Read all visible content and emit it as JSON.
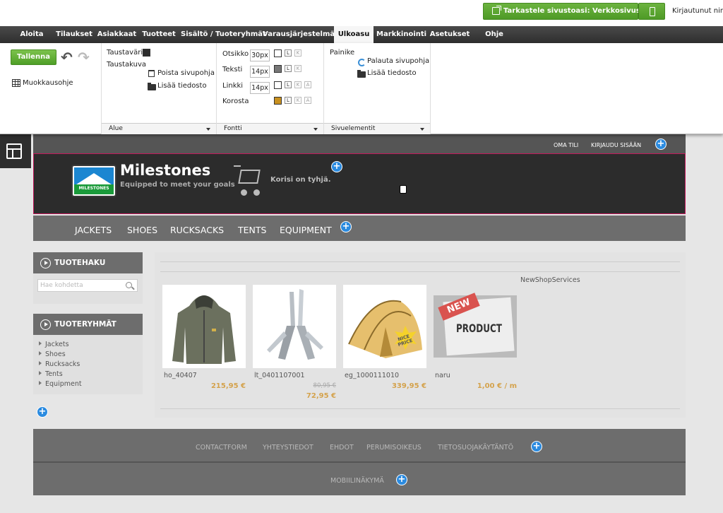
{
  "topbar": {
    "view_site_label": "Tarkastele sivustoasi: Verkkosivusto",
    "logged_in": "Kirjautunut nime"
  },
  "menu": [
    "Aloita",
    "Tilaukset",
    "Asiakkaat",
    "Tuotteet",
    "Sisältö / Tuoteryhmät",
    "Varausjärjestelmä",
    "Ulkoasu",
    "Markkinointi",
    "Asetukset",
    "Ohje"
  ],
  "menu_active": "Ulkoasu",
  "ribbon": {
    "save": "Tallenna",
    "help": "Muokkausohje",
    "area": {
      "bg_color": "Taustaväri",
      "bg_image": "Taustakuva",
      "remove_template": "Poista sivupohja",
      "add_file": "Lisää tiedosto",
      "footer": "Alue"
    },
    "font": {
      "rows": [
        {
          "label": "Otsikko",
          "size": "30px",
          "color": "#ffffff"
        },
        {
          "label": "Teksti",
          "size": "14px",
          "color": "#777777"
        },
        {
          "label": "Linkki",
          "size": "14px",
          "color": "#ffffff"
        },
        {
          "label": "Korosta",
          "size": "",
          "color": "#c8901f"
        }
      ],
      "bold": "L",
      "italic": "K",
      "underline": "A",
      "footer": "Fontti"
    },
    "elements": {
      "button": "Painike",
      "restore_template": "Palauta sivupohja",
      "add_file": "Lisää tiedosto",
      "footer": "Sivuelementit"
    }
  },
  "site": {
    "top_links": [
      "OMA TILI",
      "KIRJAUDU SISÄÄN"
    ],
    "logo_text": "MILESTONES",
    "brand": "Milestones",
    "slogan": "Equipped to meet your goals",
    "cart": "Korisi on tyhjä.",
    "nav": [
      "JACKETS",
      "SHOES",
      "RUCKSACKS",
      "TENTS",
      "EQUIPMENT"
    ],
    "search_title": "TUOTEHAKU",
    "search_placeholder": "Hae kohdetta",
    "groups_title": "TUOTERYHMÄT",
    "groups": [
      "Jackets",
      "Shoes",
      "Rucksacks",
      "Tents",
      "Equipment"
    ],
    "provider": "NewShopServices",
    "products": [
      {
        "code": "ho_40407",
        "price": "215,95 €",
        "old_price": ""
      },
      {
        "code": "lt_0401107001",
        "price": "72,95 €",
        "old_price": "80,95 €"
      },
      {
        "code": "eg_1000111010",
        "price": "339,95 €",
        "old_price": "",
        "badge": "NICE PRICE"
      },
      {
        "code": "naru",
        "price": "1,00 € / m",
        "old_price": "",
        "badge_top": "NEW",
        "badge_mid": "PRODUCT"
      }
    ],
    "footer_links": [
      "CONTACTFORM",
      "YHTEYSTIEDOT",
      "EHDOT",
      "PERUMISOIKEUS",
      "TIETOSUOJAKÄYTÄNTÖ"
    ],
    "mobile": "MOBIILINÄKYMÄ"
  },
  "colors": {
    "accent_green": "#5aa830",
    "plus_blue": "#2b8be0",
    "price": "#d4a24c",
    "header_border": "#c2185b"
  }
}
